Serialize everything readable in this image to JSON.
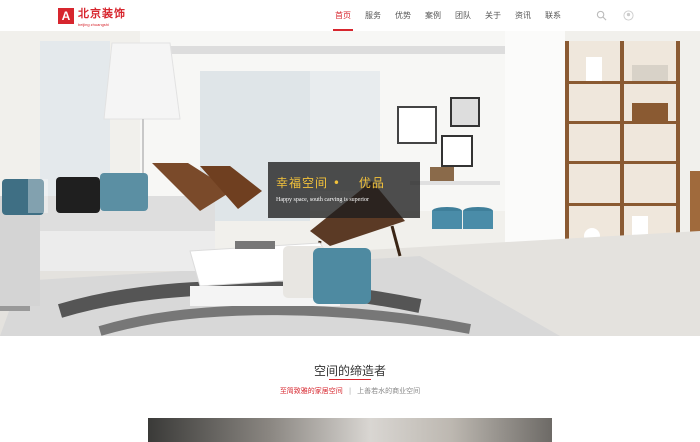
{
  "logo": {
    "mark": "A",
    "name": "北京装饰",
    "tagline": "beijing zhuangshi"
  },
  "nav": {
    "items": [
      "首页",
      "服务",
      "优势",
      "案例",
      "团队",
      "关于",
      "资讯",
      "联系"
    ],
    "active_index": 0
  },
  "header_icons": [
    "search-icon",
    "user-icon"
  ],
  "hero": {
    "title_part1": "幸福空间 •",
    "title_part2": "优品",
    "subtitle": "Happy space, south carving is superior",
    "slide_count": 3,
    "active_slide": 1
  },
  "section": {
    "title": "空间的缔造者",
    "sub1": "至简致雅的家居空间",
    "separator": "|",
    "sub2": "上善若水的商业空间"
  },
  "colors": {
    "accent": "#d7262e",
    "banner_text": "#f3c23a"
  }
}
